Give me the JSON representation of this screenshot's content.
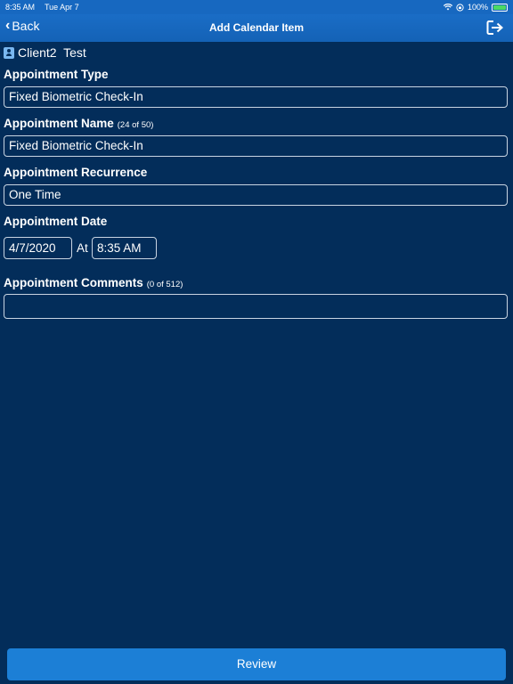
{
  "status_bar": {
    "time": "8:35 AM",
    "date": "Tue Apr 7",
    "battery": "100%",
    "icons": [
      "wifi-icon",
      "orientation-lock-icon",
      "battery-icon"
    ]
  },
  "nav": {
    "back_label": "Back",
    "title": "Add Calendar Item",
    "logout_icon": "logout-icon"
  },
  "client": {
    "icon": "contact-card-icon",
    "name": "Client2  Test"
  },
  "form": {
    "appointment_type": {
      "label": "Appointment Type",
      "value": "Fixed Biometric Check-In"
    },
    "appointment_name": {
      "label": "Appointment Name",
      "counter": "(24 of 50)",
      "value": "Fixed Biometric Check-In"
    },
    "appointment_recurrence": {
      "label": "Appointment Recurrence",
      "value": "One Time"
    },
    "appointment_date": {
      "label": "Appointment Date",
      "date": "4/7/2020",
      "at_label": "At",
      "time": "8:35 AM"
    },
    "appointment_comments": {
      "label": "Appointment Comments",
      "counter": "(0 of 512)",
      "value": ""
    }
  },
  "review_button_label": "Review",
  "colors": {
    "background": "#032d5a",
    "nav_bar": "#1768c0",
    "button": "#1c7fd6",
    "field_border": "#c8d4e2"
  }
}
